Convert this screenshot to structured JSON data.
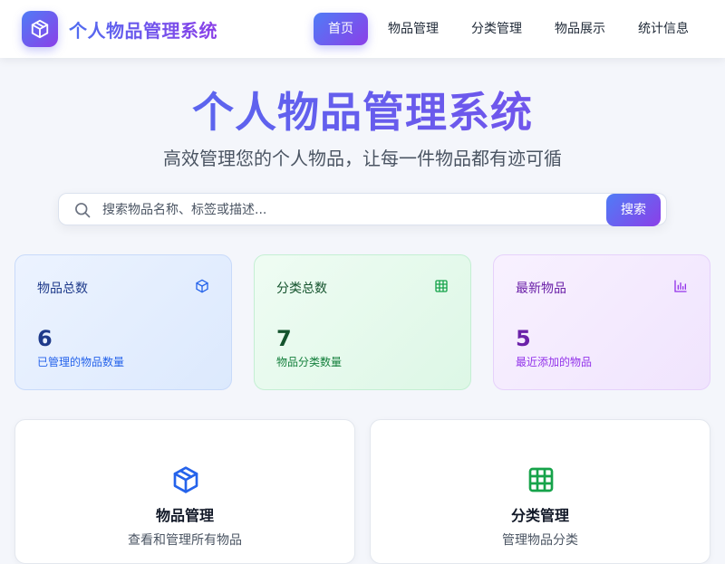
{
  "app": {
    "brand": "个人物品管理系统",
    "accent_start": "#4f7cf6",
    "accent_end": "#8b3fe8",
    "logo_icon": "cube-icon"
  },
  "nav": {
    "items": [
      {
        "label": "首页",
        "active": true
      },
      {
        "label": "物品管理",
        "active": false
      },
      {
        "label": "分类管理",
        "active": false
      },
      {
        "label": "物品展示",
        "active": false
      },
      {
        "label": "统计信息",
        "active": false
      }
    ]
  },
  "hero": {
    "title": "个人物品管理系统",
    "subtitle": "高效管理您的个人物品，让每一件物品都有迹可循"
  },
  "search": {
    "placeholder": "搜索物品名称、标签或描述...",
    "value": "",
    "button_label": "搜索",
    "icon": "search-icon"
  },
  "stats": [
    {
      "label": "物品总数",
      "value": "6",
      "desc": "已管理的物品数量",
      "icon": "cube-icon",
      "color": "#2563eb"
    },
    {
      "label": "分类总数",
      "value": "7",
      "desc": "物品分类数量",
      "icon": "grid-icon",
      "color": "#16a34a"
    },
    {
      "label": "最新物品",
      "value": "5",
      "desc": "最近添加的物品",
      "icon": "bar-chart-icon",
      "color": "#9333ea"
    }
  ],
  "features": [
    {
      "title": "物品管理",
      "desc": "查看和管理所有物品",
      "icon": "cube-icon",
      "color": "#2563eb"
    },
    {
      "title": "分类管理",
      "desc": "管理物品分类",
      "icon": "grid-icon",
      "color": "#16a34a"
    }
  ]
}
